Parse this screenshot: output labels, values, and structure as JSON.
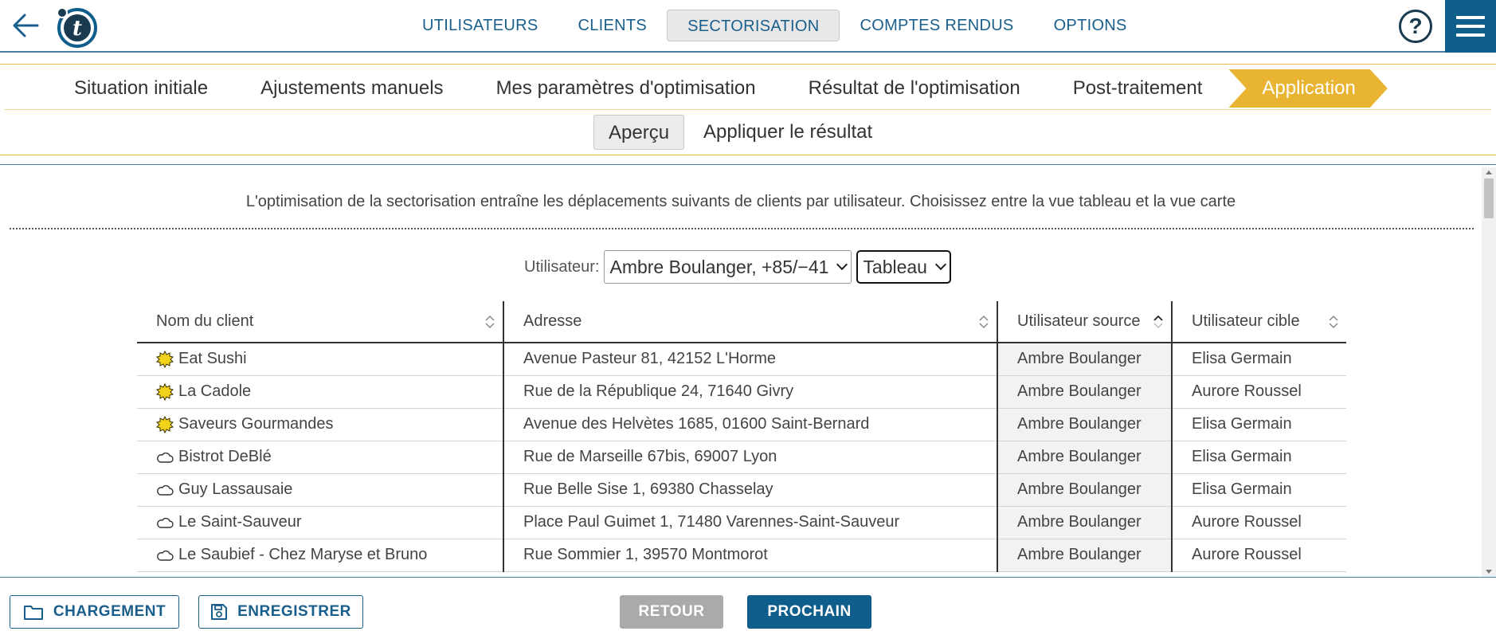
{
  "nav": {
    "tabs": [
      "UTILISATEURS",
      "CLIENTS",
      "SECTORISATION",
      "COMPTES RENDUS",
      "OPTIONS"
    ],
    "active_tab": "SECTORISATION",
    "help_label": "?"
  },
  "steps": {
    "items": [
      "Situation initiale",
      "Ajustements manuels",
      "Mes paramètres d'optimisation",
      "Résultat de l'optimisation",
      "Post-traitement",
      "Application"
    ],
    "active": "Application"
  },
  "subtabs": {
    "items": [
      "Aperçu",
      "Appliquer le résultat"
    ],
    "active": "Aperçu"
  },
  "main": {
    "intro": "L'optimisation de la sectorisation entraîne les déplacements suivants de clients par utilisateur. Choisissez entre la vue tableau et la vue carte",
    "user_label": "Utilisateur:",
    "user_select": "Ambre Boulanger, +85/−41",
    "view_select": "Tableau"
  },
  "table": {
    "headers": [
      "Nom du client",
      "Adresse",
      "Utilisateur source",
      "Utilisateur cible"
    ],
    "rows": [
      {
        "icon": "sun-icon",
        "name": "Eat Sushi",
        "address": "Avenue Pasteur 81, 42152 L'Horme",
        "source": "Ambre Boulanger",
        "target": "Elisa Germain"
      },
      {
        "icon": "sun-icon",
        "name": "La Cadole",
        "address": "Rue de la République 24, 71640 Givry",
        "source": "Ambre Boulanger",
        "target": "Aurore Roussel"
      },
      {
        "icon": "sun-icon",
        "name": "Saveurs Gourmandes",
        "address": "Avenue des Helvètes 1685, 01600 Saint-Bernard",
        "source": "Ambre Boulanger",
        "target": "Elisa Germain"
      },
      {
        "icon": "cloud-icon",
        "name": "Bistrot DeBlé",
        "address": "Rue de Marseille 67bis, 69007 Lyon",
        "source": "Ambre Boulanger",
        "target": "Elisa Germain"
      },
      {
        "icon": "cloud-icon",
        "name": "Guy Lassausaie",
        "address": "Rue Belle Sise 1, 69380 Chasselay",
        "source": "Ambre Boulanger",
        "target": "Elisa Germain"
      },
      {
        "icon": "cloud-icon",
        "name": "Le Saint-Sauveur",
        "address": "Place Paul Guimet 1, 71480 Varennes-Saint-Sauveur",
        "source": "Ambre Boulanger",
        "target": "Aurore Roussel"
      },
      {
        "icon": "cloud-icon",
        "name": "Le Saubief - Chez Maryse et Bruno",
        "address": "Rue Sommier 1, 39570 Montmorot",
        "source": "Ambre Boulanger",
        "target": "Aurore Roussel"
      }
    ]
  },
  "footer": {
    "load_label": "CHARGEMENT",
    "save_label": "ENREGISTRER",
    "back_label": "RETOUR",
    "next_label": "PROCHAIN"
  },
  "colors": {
    "brand_blue": "#0e5d8b",
    "step_active": "#e9b431",
    "nav_text": "#1a5f8c"
  }
}
